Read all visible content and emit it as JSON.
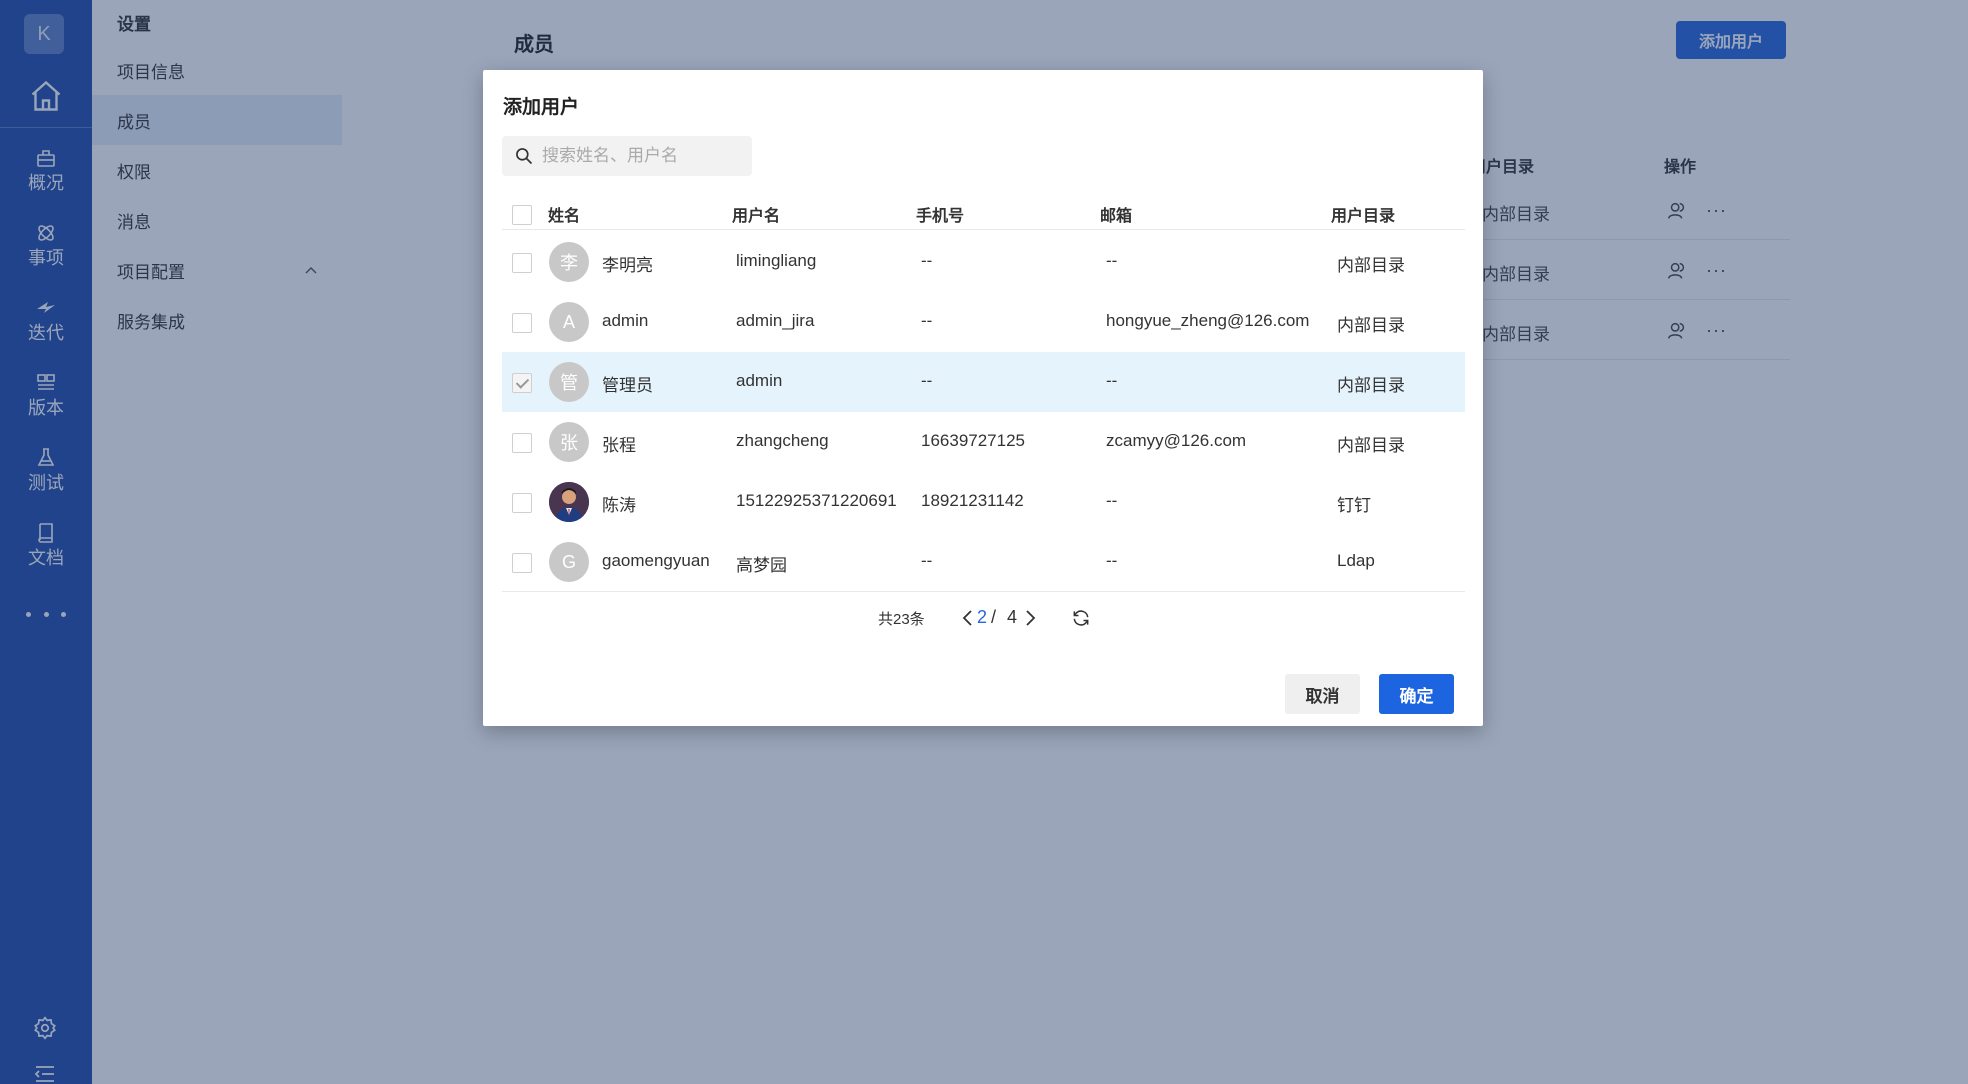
{
  "rail": {
    "logo": "K",
    "items": [
      {
        "label": "概况",
        "icon": "overview-icon"
      },
      {
        "label": "事项",
        "icon": "issues-icon"
      },
      {
        "label": "迭代",
        "icon": "sprint-icon"
      },
      {
        "label": "版本",
        "icon": "version-icon"
      },
      {
        "label": "测试",
        "icon": "test-icon"
      },
      {
        "label": "文档",
        "icon": "document-icon"
      }
    ]
  },
  "settings": {
    "title": "设置",
    "items": [
      {
        "label": "项目信息"
      },
      {
        "label": "成员"
      },
      {
        "label": "权限"
      },
      {
        "label": "消息"
      },
      {
        "label": "项目配置"
      },
      {
        "label": "服务集成"
      }
    ],
    "active_index": 1
  },
  "page": {
    "title": "成员",
    "add_user_button": "添加用户",
    "columns": [
      "用户目录",
      "操作"
    ],
    "rows": [
      {
        "directory": "内部目录"
      },
      {
        "directory": "内部目录"
      },
      {
        "directory": "内部目录"
      }
    ]
  },
  "modal": {
    "title": "添加用户",
    "search_placeholder": "搜索姓名、用户名",
    "columns": {
      "name": "姓名",
      "username": "用户名",
      "phone": "手机号",
      "email": "邮箱",
      "directory": "用户目录"
    },
    "rows": [
      {
        "avatar": "李",
        "name": "李明亮",
        "username": "limingliang",
        "phone": "--",
        "email": "--",
        "directory": "内部目录",
        "checked": false
      },
      {
        "avatar": "A",
        "name": "admin",
        "username": "admin_jira",
        "phone": "--",
        "email": "hongyue_zheng@126.com",
        "directory": "内部目录",
        "checked": false
      },
      {
        "avatar": "管",
        "name": "管理员",
        "username": "admin",
        "phone": "--",
        "email": "--",
        "directory": "内部目录",
        "checked": true
      },
      {
        "avatar": "张",
        "name": "张程",
        "username": "zhangcheng",
        "phone": "16639727125",
        "email": "zcamyy@126.com",
        "directory": "内部目录",
        "checked": false
      },
      {
        "avatar": "",
        "name": "陈涛",
        "username": "15122925371220691",
        "phone": "18921231142",
        "email": "--",
        "directory": "钉钉",
        "checked": false
      },
      {
        "avatar": "G",
        "name": "gaomengyuan",
        "username": "高梦园",
        "phone": "--",
        "email": "--",
        "directory": "Ldap",
        "checked": false
      }
    ],
    "pagination": {
      "total": "共23条",
      "current": "2",
      "separator": "/",
      "pages": "4"
    },
    "cancel": "取消",
    "confirm": "确定"
  },
  "colors": {
    "rail": "#214ea9",
    "primary": "#1c64e0",
    "selected_row": "#e5f4fc"
  }
}
